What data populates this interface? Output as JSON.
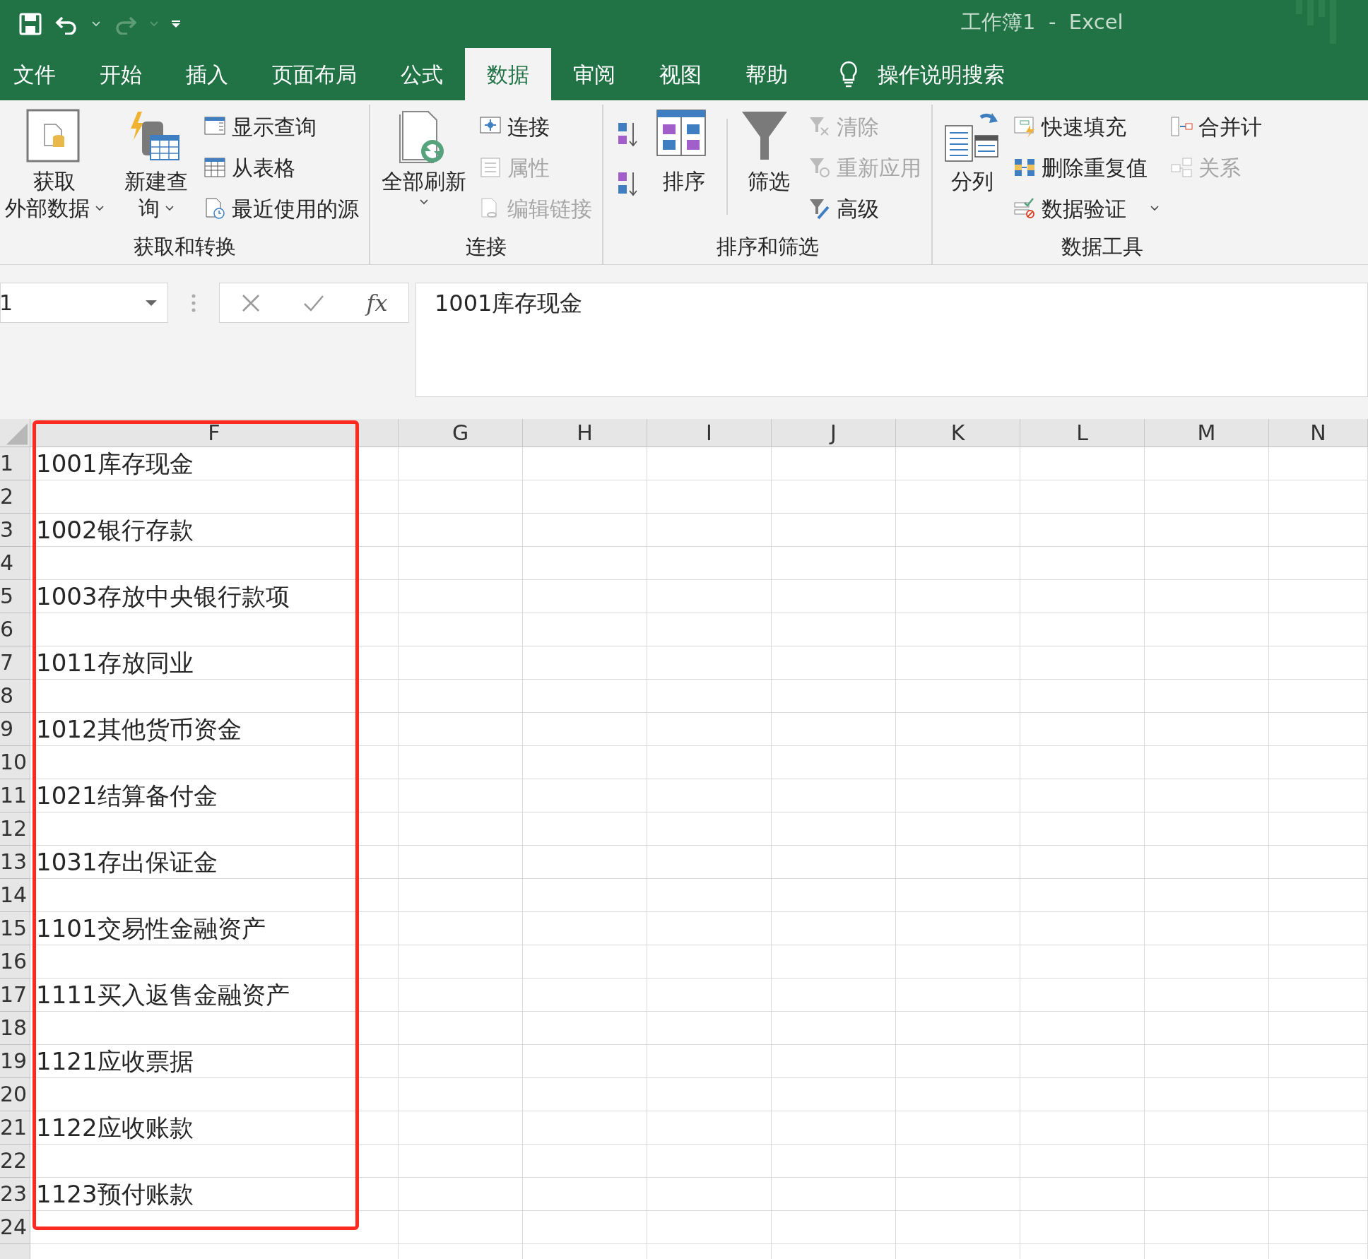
{
  "window": {
    "title": "工作簿1  -  Excel"
  },
  "quick_access": [
    {
      "kind": "save",
      "disabled": false
    },
    {
      "kind": "undo",
      "disabled": false
    },
    {
      "kind": "redo",
      "disabled": true
    },
    {
      "kind": "customize",
      "disabled": false
    }
  ],
  "tabs": [
    {
      "label": "文件",
      "selected": false
    },
    {
      "label": "开始",
      "selected": false
    },
    {
      "label": "插入",
      "selected": false
    },
    {
      "label": "页面布局",
      "selected": false
    },
    {
      "label": "公式",
      "selected": false
    },
    {
      "label": "数据",
      "selected": true
    },
    {
      "label": "审阅",
      "selected": false
    },
    {
      "label": "视图",
      "selected": false
    },
    {
      "label": "帮助",
      "selected": false
    }
  ],
  "tell_me": {
    "placeholder": "操作说明搜索"
  },
  "ribbon": {
    "groups": [
      {
        "label": "获取和转换",
        "items": [
          {
            "kind": "large",
            "lines": [
              "获取",
              "外部数据"
            ],
            "dropdown": true,
            "disabled": false
          },
          {
            "kind": "large",
            "lines": [
              "新建查",
              "询"
            ],
            "dropdown": true,
            "disabled": false
          },
          {
            "kind": "stack",
            "items": [
              {
                "label": "显示查询",
                "disabled": false,
                "dropdown": false
              },
              {
                "label": "从表格",
                "disabled": false,
                "dropdown": false
              },
              {
                "label": "最近使用的源",
                "disabled": false,
                "dropdown": false
              }
            ]
          }
        ]
      },
      {
        "label": "连接",
        "items": [
          {
            "kind": "large",
            "lines": [
              "全部刷新"
            ],
            "dropdown": true,
            "disabled": false
          },
          {
            "kind": "stack",
            "items": [
              {
                "label": "连接",
                "disabled": false,
                "dropdown": false
              },
              {
                "label": "属性",
                "disabled": true,
                "dropdown": false
              },
              {
                "label": "编辑链接",
                "disabled": true,
                "dropdown": false
              }
            ]
          }
        ]
      },
      {
        "label": "排序和筛选",
        "items": [
          {
            "kind": "sort"
          },
          {
            "kind": "large",
            "lines": [
              "排序"
            ],
            "dropdown": false,
            "disabled": false
          },
          {
            "kind": "separator"
          },
          {
            "kind": "large",
            "lines": [
              "筛选"
            ],
            "dropdown": false,
            "disabled": false
          },
          {
            "kind": "stack",
            "items": [
              {
                "label": "清除",
                "disabled": true,
                "dropdown": false
              },
              {
                "label": "重新应用",
                "disabled": true,
                "dropdown": false
              },
              {
                "label": "高级",
                "disabled": false,
                "dropdown": false
              }
            ]
          }
        ]
      },
      {
        "label": "数据工具",
        "items": [
          {
            "kind": "large",
            "lines": [
              "分列"
            ],
            "dropdown": false,
            "disabled": false
          },
          {
            "kind": "stack",
            "items": [
              {
                "label": "快速填充",
                "disabled": false,
                "dropdown": false
              },
              {
                "label": "删除重复值",
                "disabled": false,
                "dropdown": false
              },
              {
                "label": "数据验证",
                "disabled": false,
                "dropdown": true
              }
            ]
          },
          {
            "kind": "stack",
            "items": [
              {
                "label": "合并计",
                "disabled": false,
                "dropdown": false
              },
              {
                "label": "关系",
                "disabled": true,
                "dropdown": false
              }
            ]
          }
        ]
      }
    ]
  },
  "name_box": {
    "value": "1"
  },
  "formula_bar": {
    "fx": "fx",
    "value": "1001库存现金"
  },
  "sheet": {
    "columns": [
      "F",
      "G",
      "H",
      "I",
      "J",
      "K",
      "L",
      "M",
      "N"
    ],
    "rows": [
      {
        "number": "1",
        "value": "1001库存现金"
      },
      {
        "number": "2"
      },
      {
        "number": "3",
        "value": "1002银行存款"
      },
      {
        "number": "4"
      },
      {
        "number": "5",
        "value": "1003存放中央银行款项"
      },
      {
        "number": "6"
      },
      {
        "number": "7",
        "value": "1011存放同业"
      },
      {
        "number": "8"
      },
      {
        "number": "9",
        "value": "1012其他货币资金"
      },
      {
        "number": "10"
      },
      {
        "number": "11",
        "value": "1021结算备付金"
      },
      {
        "number": "12"
      },
      {
        "number": "13",
        "value": "1031存出保证金"
      },
      {
        "number": "14"
      },
      {
        "number": "15",
        "value": "1101交易性金融资产"
      },
      {
        "number": "16"
      },
      {
        "number": "17",
        "value": "1111买入返售金融资产"
      },
      {
        "number": "18"
      },
      {
        "number": "19",
        "value": "1121应收票据"
      },
      {
        "number": "20"
      },
      {
        "number": "21",
        "value": "1122应收账款"
      },
      {
        "number": "22"
      },
      {
        "number": "23",
        "value": "1123预付账款"
      },
      {
        "number": "24"
      }
    ],
    "highlight": {
      "color": "#ff2a1f"
    }
  }
}
